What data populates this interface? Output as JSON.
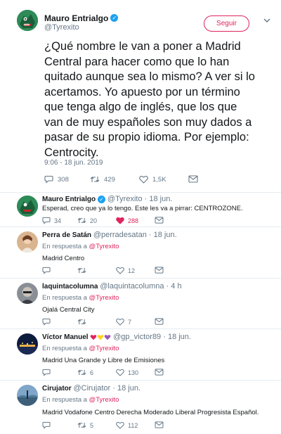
{
  "main_tweet": {
    "name": "Mauro Entrialgo",
    "handle": "@Tyrexito",
    "follow_label": "Seguir",
    "text": "¿Qué nombre le van a poner a Madrid Central para hacer como que lo han quitado aunque sea lo mismo? A ver si lo acertamos. Yo apuesto por un término que tenga algo de inglés, que los que van de muy españoles son muy dados a pasar de su propio idioma. Por ejemplo: Centrocity.",
    "timestamp": "9:06 - 18 jun. 2019",
    "replies": "308",
    "retweets": "429",
    "likes": "1,5K"
  },
  "replies": [
    {
      "name": "Mauro Entrialgo",
      "handle": "@Tyrexito · 18 jun.",
      "in_reply": "",
      "text": "Esperad, creo que ya lo tengo. Este les va a pirrar: CENTROZONE.",
      "replies": "34",
      "retweets": "20",
      "likes": "288",
      "liked": true,
      "verified": true
    },
    {
      "name": "Perra de Satán",
      "handle": "@perradesatan · 18 jun.",
      "in_reply_prefix": "En respuesta a",
      "in_reply_mention": "@Tyrexito",
      "text": "Madrid Centro",
      "replies": "",
      "retweets": "",
      "likes": "12",
      "liked": false
    },
    {
      "name": "laquintacolumna",
      "handle": "@laquintacolumna · 4 h",
      "in_reply_prefix": "En respuesta a",
      "in_reply_mention": "@Tyrexito",
      "text": "Ojalá Central City",
      "replies": "",
      "retweets": "",
      "likes": "7",
      "liked": false
    },
    {
      "name": "Víctor Manuel",
      "handle": "@gp_victor89 · 18 jun.",
      "in_reply_prefix": "En respuesta a",
      "in_reply_mention": "@Tyrexito",
      "text": "Madrid Una Grande y Libre de Emisiones",
      "replies": "",
      "retweets": "6",
      "likes": "130",
      "liked": false,
      "emoji_hearts": [
        "#e0245e",
        "#ffd21f",
        "#9b59b6"
      ]
    },
    {
      "name": "Cirujator",
      "handle": "@Cirujator · 18 jun.",
      "in_reply_prefix": "En respuesta a",
      "in_reply_mention": "@Tyrexito",
      "text": "Madrid Vodafone Centro Derecha Moderado Liberal Progresista Español.",
      "replies": "",
      "retweets": "5",
      "likes": "112",
      "liked": false
    }
  ],
  "colors": {
    "accent": "#e0245e",
    "verified": "#1da1f2",
    "muted": "#657786"
  }
}
